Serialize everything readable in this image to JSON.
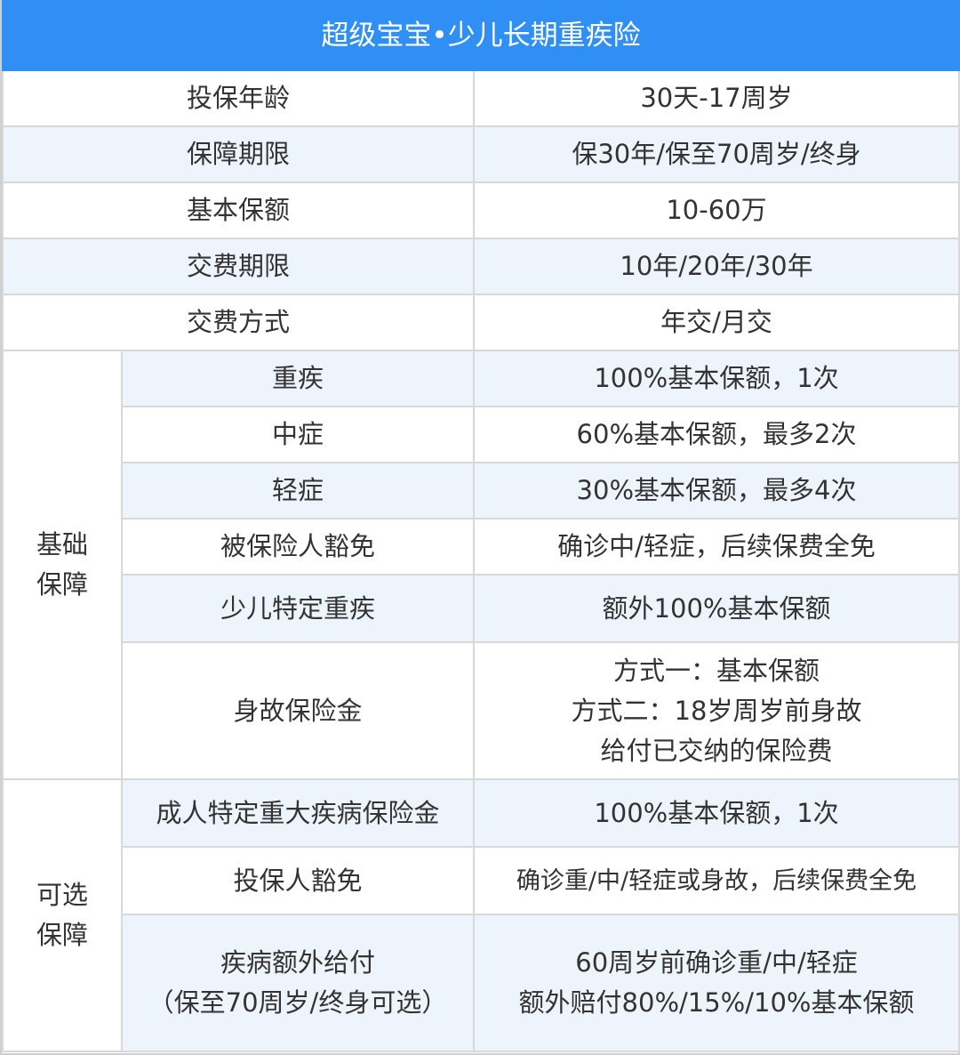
{
  "title": "超级宝宝•少儿长期重疾险",
  "basic_rows": [
    {
      "label": "投保年龄",
      "value": "30天-17周岁"
    },
    {
      "label": "保障期限",
      "value": "保30年/保至70周岁/终身"
    },
    {
      "label": "基本保额",
      "value": "10-60万"
    },
    {
      "label": "交费期限",
      "value": "10年/20年/30年"
    },
    {
      "label": "交费方式",
      "value": "年交/月交"
    }
  ],
  "groups": [
    {
      "name_lines": [
        "基础",
        "保障"
      ],
      "rows": [
        {
          "label_lines": [
            "重疾"
          ],
          "value_lines": [
            "100%基本保额，1次"
          ]
        },
        {
          "label_lines": [
            "中症"
          ],
          "value_lines": [
            "60%基本保额，最多2次"
          ]
        },
        {
          "label_lines": [
            "轻症"
          ],
          "value_lines": [
            "30%基本保额，最多4次"
          ]
        },
        {
          "label_lines": [
            "被保险人豁免"
          ],
          "value_lines": [
            "确诊中/轻症，后续保费全免"
          ]
        },
        {
          "label_lines": [
            "少儿特定重疾"
          ],
          "value_lines": [
            "额外100%基本保额"
          ]
        },
        {
          "label_lines": [
            "身故保险金"
          ],
          "value_lines": [
            "方式一：基本保额",
            "方式二：18岁周岁前身故",
            "给付已交纳的保险费"
          ]
        }
      ]
    },
    {
      "name_lines": [
        "可选",
        "保障"
      ],
      "rows": [
        {
          "label_lines": [
            "成人特定重大疾病保险金"
          ],
          "value_lines": [
            "100%基本保额，1次"
          ]
        },
        {
          "label_lines": [
            "投保人豁免"
          ],
          "value_lines": [
            "确诊重/中/轻症或身故，后续保费全免"
          ]
        },
        {
          "label_lines": [
            "疾病额外给付",
            "（保至70周岁/终身可选）"
          ],
          "value_lines": [
            "60周岁前确诊重/中/轻症",
            "额外赔付80%/15%/10%基本保额"
          ]
        }
      ]
    }
  ],
  "colors": {
    "header_bg": "#2f8ff5",
    "stripe_bg": "#eef4fc",
    "border": "#d8d8d8",
    "text": "#333333"
  }
}
